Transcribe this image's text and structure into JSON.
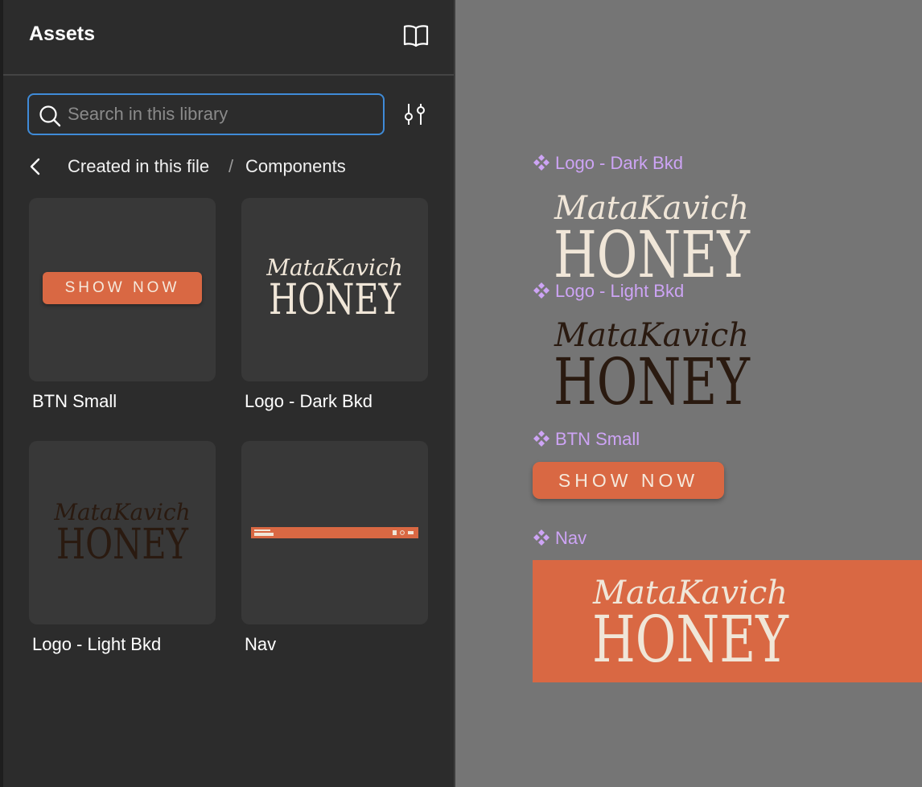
{
  "panel": {
    "title": "Assets",
    "search_placeholder": "Search in this library",
    "breadcrumb": {
      "parent": "Created in this file",
      "separator": "/",
      "current": "Components"
    },
    "cards": [
      {
        "label": "BTN Small",
        "button_text": "SHOW NOW"
      },
      {
        "label": "Logo - Dark Bkd",
        "logo_script": "MataKavich",
        "logo_word": "HONEY"
      },
      {
        "label": "Logo - Light Bkd",
        "logo_script": "MataKavich",
        "logo_word": "HONEY"
      },
      {
        "label": "Nav"
      }
    ]
  },
  "canvas": {
    "components": [
      {
        "label": "Logo - Dark Bkd",
        "logo_script": "MataKavich",
        "logo_word": "HONEY"
      },
      {
        "label": "Logo - Light Bkd",
        "logo_script": "MataKavich",
        "logo_word": "HONEY"
      },
      {
        "label": "BTN Small",
        "button_text": "SHOW NOW"
      },
      {
        "label": "Nav",
        "logo_script": "MataKavich",
        "logo_word": "HONEY"
      }
    ]
  },
  "colors": {
    "panel_bg": "#2c2c2c",
    "card_bg": "#383838",
    "canvas_bg": "#757575",
    "accent_orange": "#d96843",
    "logo_cream": "#f0e6d8",
    "logo_dark": "#2a1a10",
    "component_label": "#cda4f5",
    "search_focus": "#3f8bd8"
  },
  "icons": {
    "library": "book-icon",
    "search": "search-icon",
    "filter": "sliders-icon",
    "back": "chevron-left-icon",
    "component": "component-icon"
  }
}
